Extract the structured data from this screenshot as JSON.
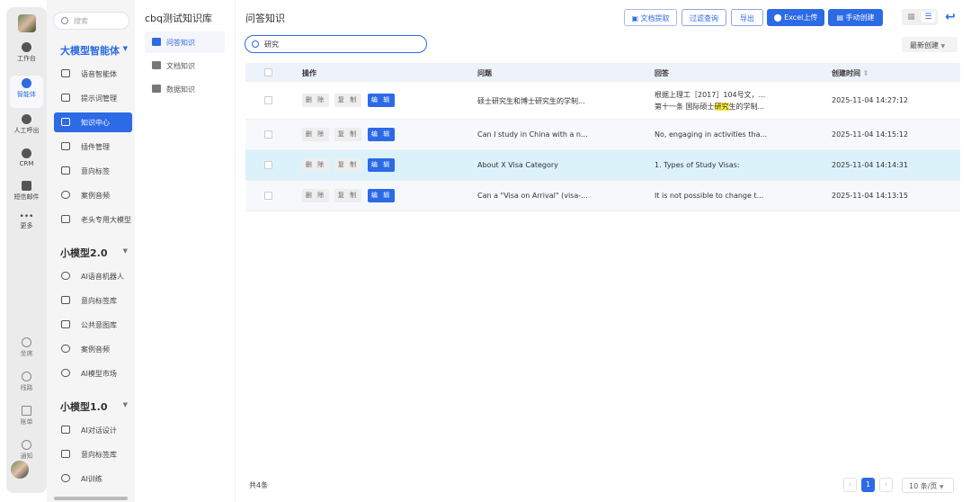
{
  "rail": {
    "items": [
      {
        "label": "工作台"
      },
      {
        "label": "智能体"
      },
      {
        "label": "人工呼出"
      },
      {
        "label": "CRM"
      },
      {
        "label": "短信邮件"
      },
      {
        "label": "更多"
      },
      {
        "label": "坐席"
      },
      {
        "label": "线路"
      },
      {
        "label": "账单"
      },
      {
        "label": "通知"
      }
    ]
  },
  "sidebar": {
    "search_placeholder": "搜索",
    "groups": [
      {
        "title": "大模型智能体",
        "items": [
          "语音智能体",
          "提示词管理",
          "知识中心",
          "插件管理",
          "意向标签",
          "案例音频",
          "老头专用大模型"
        ]
      },
      {
        "title": "小模型2.0",
        "items": [
          "AI语音机器人",
          "意向标签库",
          "公共意图库",
          "案例音频",
          "AI模型市场"
        ]
      },
      {
        "title": "小模型1.0",
        "items": [
          "AI对话设计",
          "意向标签库",
          "AI训练"
        ]
      }
    ]
  },
  "kb": {
    "title": "cbq测试知识库",
    "items": [
      "问答知识",
      "文档知识",
      "数据知识"
    ]
  },
  "main": {
    "title": "问答知识",
    "buttons": {
      "doc_extract": "文档提取",
      "filter": "过滤查询",
      "export": "导出",
      "excel": "Excel上传",
      "manual": "手动创建"
    },
    "search_value": "研究",
    "sort": "最新创建",
    "columns": [
      "操作",
      "问题",
      "回答",
      "创建时间"
    ],
    "actions": {
      "delete": "删 除",
      "copy": "复 制",
      "edit": "编 辑"
    },
    "rows": [
      {
        "question": "硕士研究生和博士研究生的学制...",
        "answer1": "根据上理工［2017］104号文，...",
        "answer2_pre": "第十一条 国际硕士",
        "answer2_hl": "研究",
        "answer2_post": "生的学制...",
        "time": "2025-11-04 14:27:12"
      },
      {
        "question": "Can I study in China with a n...",
        "answer1": "No, engaging in activities tha...",
        "time": "2025-11-04 14:15:12"
      },
      {
        "question": "About X Visa Category",
        "answer1": "1. Types of Study Visas:",
        "time": "2025-11-04 14:14:31"
      },
      {
        "question": "Can a \"Visa on Arrival\" (visa-...",
        "answer1": "It is not possible to change t...",
        "time": "2025-11-04 14:13:15"
      }
    ],
    "total": "共4条",
    "page": "1",
    "page_size": "10 条/页"
  },
  "colors": {
    "accent": "#2c6ae6",
    "highlight_row": "#dbf2fb"
  }
}
